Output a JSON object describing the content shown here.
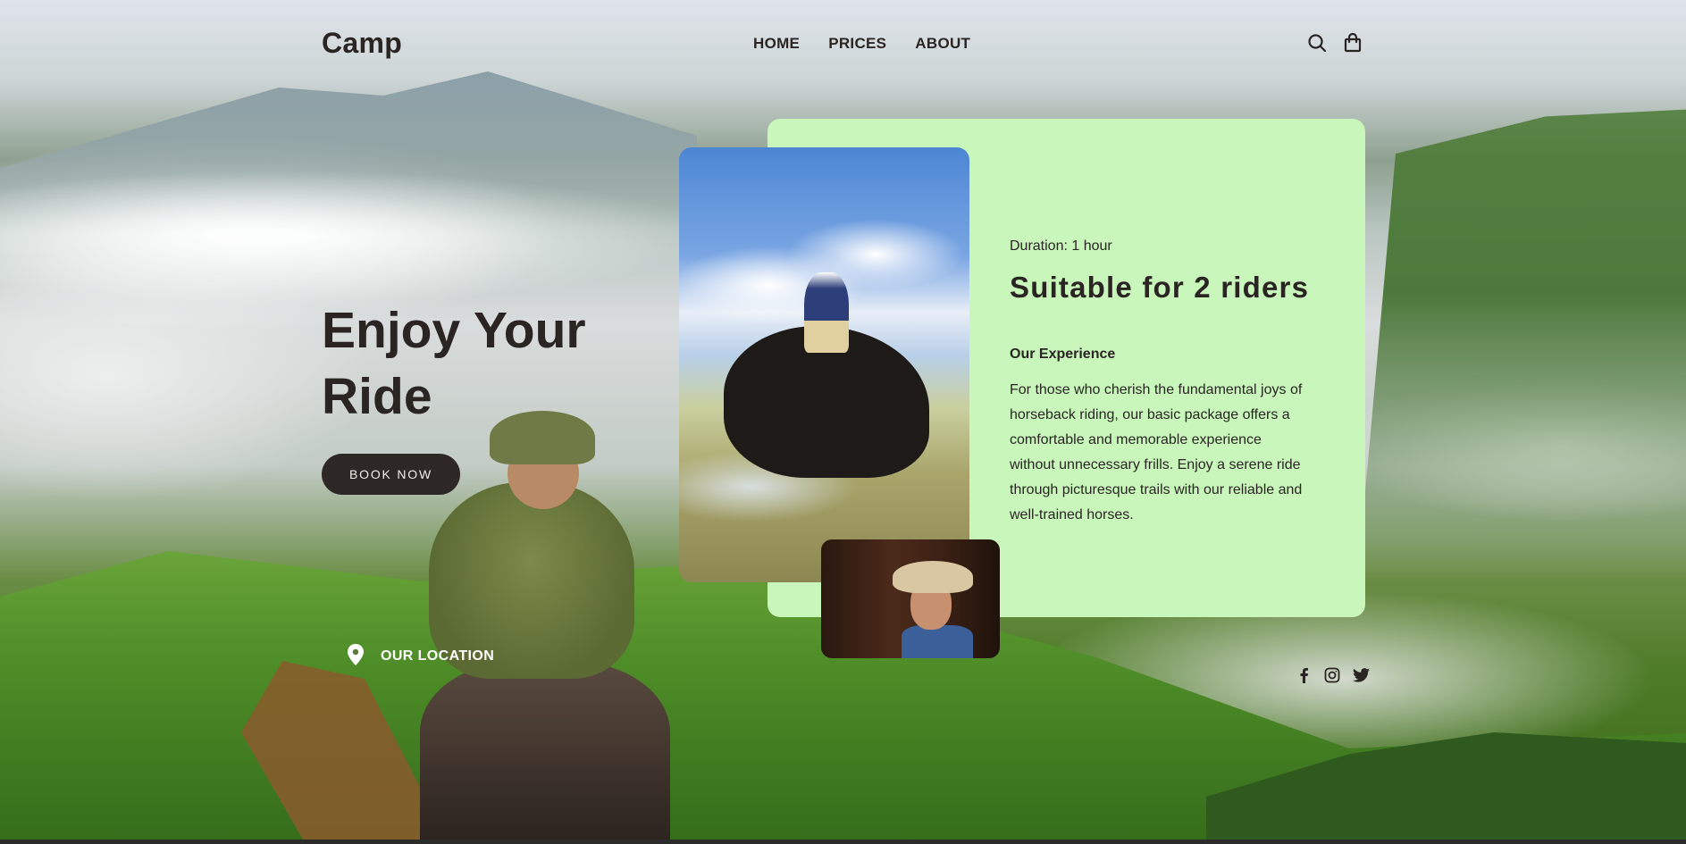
{
  "header": {
    "logo": "Camp",
    "nav": [
      "HOME",
      "PRICES",
      "ABOUT"
    ],
    "icons": [
      "search-icon",
      "shopping-bag-icon"
    ]
  },
  "hero": {
    "title": "Enjoy Your Ride",
    "book_button": "BOOK NOW",
    "location_label": "OUR LOCATION"
  },
  "card": {
    "duration": "Duration: 1 hour",
    "title": "Suitable for 2 riders",
    "subtitle": "Our Experience",
    "description": "For those who cherish the fundamental joys of horseback riding, our basic package offers a comfortable and memorable experience without unnecessary frills. Enjoy a serene ride through picturesque trails with our reliable and well-trained horses."
  },
  "socials": [
    "facebook-icon",
    "instagram-icon",
    "twitter-icon"
  ],
  "colors": {
    "card_bg": "#c8f6bb",
    "button_bg": "#2d2725",
    "text_dark": "#2a2523"
  }
}
